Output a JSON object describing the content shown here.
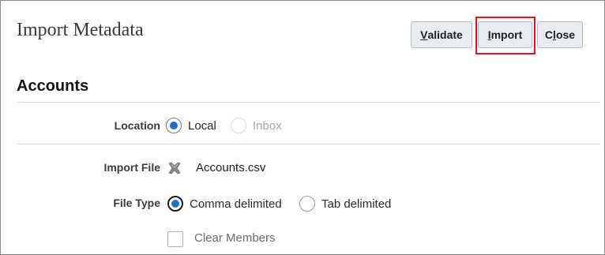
{
  "header": {
    "title": "Import Metadata",
    "buttons": {
      "validate": {
        "prefix": "",
        "mnemonic": "V",
        "rest": "alidate"
      },
      "import": {
        "prefix": "",
        "mnemonic": "I",
        "rest": "mport"
      },
      "close": {
        "prefix": "C",
        "mnemonic": "l",
        "rest": "ose"
      }
    }
  },
  "section": {
    "title": "Accounts"
  },
  "form": {
    "location": {
      "label": "Location",
      "options": [
        {
          "label": "Local",
          "selected": true,
          "enabled": true
        },
        {
          "label": "Inbox",
          "selected": false,
          "enabled": false
        }
      ]
    },
    "import_file": {
      "label": "Import File",
      "icon": "clear-x-icon",
      "value": "Accounts.csv"
    },
    "file_type": {
      "label": "File Type",
      "options": [
        {
          "label": "Comma delimited",
          "selected": true
        },
        {
          "label": "Tab delimited",
          "selected": false
        }
      ]
    },
    "clear_members": {
      "label": "Clear Members",
      "checked": false
    }
  },
  "colors": {
    "accent": "#1f6fd1",
    "highlight": "#e0141e"
  }
}
